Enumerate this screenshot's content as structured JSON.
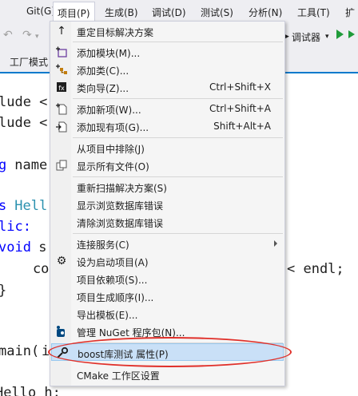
{
  "menubar": {
    "items": [
      "Git(G)",
      "项目(P)",
      "生成(B)",
      "调试(D)",
      "测试(S)",
      "分析(N)",
      "工具(T)",
      "扩"
    ]
  },
  "toolbar": {
    "debugger_label": "调试器",
    "overflow": "▾"
  },
  "tabs": [
    "工厂模式"
  ],
  "editor": {
    "lines": {
      "l1_a": "lude <",
      "l2_a": "lude <",
      "l3_kw": "g",
      "l3_b": " name",
      "l4_kw": "s",
      "l4_ty": " Hell",
      "l5_kw": "lic:",
      "l6_kw": "void",
      "l6_b": " s",
      "l7_a": "    co",
      "l7_b": "< endl;",
      "l8_a": "}",
      "l9_a": "main(",
      "l9_b": "i",
      "l10_a": "Hello h;"
    }
  },
  "menu": {
    "items": [
      {
        "label": "重定目标解决方案",
        "icon": "up-arrow-icon",
        "shortcut": ""
      },
      {
        "label": "添加模块(M)...",
        "icon": "add-module-icon",
        "shortcut": ""
      },
      {
        "label": "添加类(C)...",
        "icon": "add-class-icon",
        "shortcut": ""
      },
      {
        "label": "类向导(Z)...",
        "icon": "class-wizard-icon",
        "shortcut": "Ctrl+Shift+X"
      },
      {
        "label": "添加新项(W)...",
        "icon": "add-new-item-icon",
        "shortcut": "Ctrl+Shift+A"
      },
      {
        "label": "添加现有项(G)...",
        "icon": "add-existing-item-icon",
        "shortcut": "Shift+Alt+A"
      },
      {
        "label": "从项目中排除(J)",
        "icon": "",
        "shortcut": ""
      },
      {
        "label": "显示所有文件(O)",
        "icon": "show-all-files-icon",
        "shortcut": ""
      },
      {
        "label": "重新扫描解决方案(S)",
        "icon": "",
        "shortcut": ""
      },
      {
        "label": "显示浏览数据库错误",
        "icon": "",
        "shortcut": ""
      },
      {
        "label": "清除浏览数据库错误",
        "icon": "",
        "shortcut": ""
      },
      {
        "label": "连接服务(C)",
        "icon": "",
        "shortcut": ""
      },
      {
        "label": "设为启动项目(A)",
        "icon": "gear-icon",
        "shortcut": ""
      },
      {
        "label": "项目依赖项(S)...",
        "icon": "",
        "shortcut": ""
      },
      {
        "label": "项目生成顺序(I)...",
        "icon": "",
        "shortcut": ""
      },
      {
        "label": "导出模板(E)...",
        "icon": "",
        "shortcut": ""
      },
      {
        "label": "管理 NuGet 程序包(N)...",
        "icon": "nuget-icon",
        "shortcut": ""
      },
      {
        "label": "boost库测试 属性(P)",
        "icon": "wrench-icon",
        "shortcut": ""
      },
      {
        "label": "CMake 工作区设置",
        "icon": "",
        "shortcut": ""
      }
    ]
  },
  "colors": {
    "highlight_bg": "#c9e0f7",
    "annotation": "#e0302a",
    "accent": "#007acc"
  }
}
